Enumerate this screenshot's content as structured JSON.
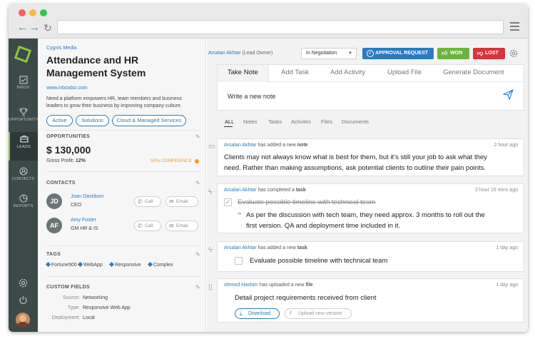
{
  "company": "Cygnis Media",
  "title_line1": "Attendance and HR",
  "title_line2": "Management System",
  "website": "www.inboxbiz.com",
  "description_line1": "Need a platform empowers HR, team members and business",
  "description_line2": "leaders to grow their business by improving company culture.",
  "pills": [
    "Active",
    "Solutions",
    "Cloud & Managed Services"
  ],
  "sidebar": {
    "items": [
      {
        "label": "INBOX",
        "icon": "inbox-icon"
      },
      {
        "label": "OPPORTUNITY",
        "icon": "trophy-icon"
      },
      {
        "label": "LEADS",
        "icon": "briefcase-icon"
      },
      {
        "label": "CONTACTS",
        "icon": "contacts-icon"
      },
      {
        "label": "REPORTS",
        "icon": "pie-chart-icon"
      }
    ]
  },
  "opportunities": {
    "heading": "OPPORTUNITIES",
    "amount": "$ 130,000",
    "gross_label": "Gross Profit:",
    "gross_value": "12%",
    "confidence": "50% CONFIDENCE"
  },
  "contacts": {
    "heading": "CONTACTS",
    "call_label": "Call",
    "email_label": "Email",
    "people": [
      {
        "initials": "JD",
        "name": "Joan Davidson",
        "role": "CEO"
      },
      {
        "initials": "AF",
        "name": "Amy Foster",
        "role": "GM HR & IS"
      }
    ]
  },
  "tags": {
    "heading": "TAGS",
    "items": [
      "Fortune500",
      "WebApp",
      "Responsive",
      "Complex"
    ]
  },
  "custom_fields": {
    "heading": "CUSTOM FIELDS",
    "rows": [
      {
        "label": "Source:",
        "value": "Networking"
      },
      {
        "label": "Type:",
        "value": "Responsive Web App"
      },
      {
        "label": "Deployment:",
        "value": "Local"
      }
    ]
  },
  "header": {
    "owner_name": "Arsalan Akhtar",
    "owner_role": "(Lead Owner)",
    "status_select": "In Negotiation",
    "approval_button": "APPROVAL REQUEST",
    "won_button": "WON",
    "lost_button": "LOST"
  },
  "colors": {
    "accent": "#2c7bbf",
    "won": "#6cb33f",
    "lost": "#d9343b",
    "sidebar": "#3c4a4a",
    "logo": "#8cc63f"
  },
  "tabs": [
    "Take Note",
    "Add Task",
    "Add Activity",
    "Upload File",
    "Generate Document"
  ],
  "note_placeholder": "Write a new note",
  "filters": [
    "ALL",
    "Notes",
    "Tasks",
    "Activites",
    "Files",
    "Documents"
  ],
  "feed": [
    {
      "user": "Arsalan Akhtar",
      "action": "has added a new",
      "object": "note",
      "time": "2 hour ago",
      "text_line1": "Clients may not always know what is best for them, but it’s still your job to ask what they",
      "text_line2": "need. Rather than making assumptions, ask potential clients to outline their pain points."
    },
    {
      "user": "Arsalan Akhtar",
      "action": "has completed a",
      "object": "task",
      "time": "2 hour 10 mins ago",
      "task": "Evaluate possible timeline with technical team",
      "comment_line1": "As per the discussion with tech team, they need approx. 3 months to roll out the",
      "comment_line2": "first version. QA and deployment time included in it."
    },
    {
      "user": "Arsalan Akhtar",
      "action": "has added a new",
      "object": "task",
      "time": "1 day ago",
      "task": "Evaluate possible timeline with technical team"
    },
    {
      "user": "Ahmed Hashim",
      "action": "has uploaded a new",
      "object": "file",
      "time": "1 day ago",
      "text": "Detail project requirements received from client",
      "download": "Download",
      "upload": "Upload new version"
    }
  ]
}
